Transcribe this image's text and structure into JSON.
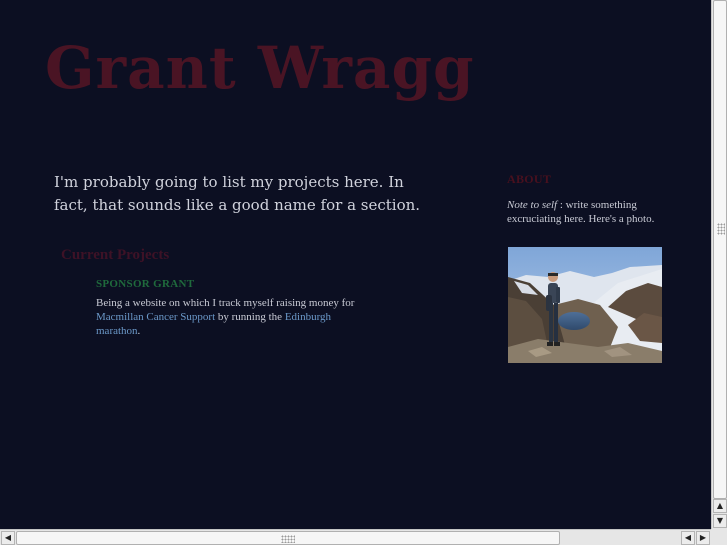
{
  "header": {
    "site_title": "Grant Wragg"
  },
  "main": {
    "intro": "I'm probably going to list my projects here. In fact, that sounds like a good name for a section.",
    "section_heading": "Current Projects",
    "projects": [
      {
        "title": "SPONSOR GRANT",
        "desc_before": "Being a website on which I track myself raising money for ",
        "link1": "Macmillan Cancer Support",
        "desc_middle": " by running the ",
        "link2": "Edinburgh marathon",
        "desc_after": "."
      }
    ]
  },
  "sidebar": {
    "heading": "ABOUT",
    "note_label": "Note to self",
    "note_text": " : write something excruciating here. Here's a photo."
  },
  "scrollbars": {
    "up_arrow": "▲",
    "down_arrow": "▼",
    "left_arrow": "◀",
    "right_arrow": "▶"
  },
  "colors": {
    "background": "#0c0f22",
    "title": "#4a1424",
    "project_title": "#1f6a3c",
    "link": "#6b98c8"
  }
}
